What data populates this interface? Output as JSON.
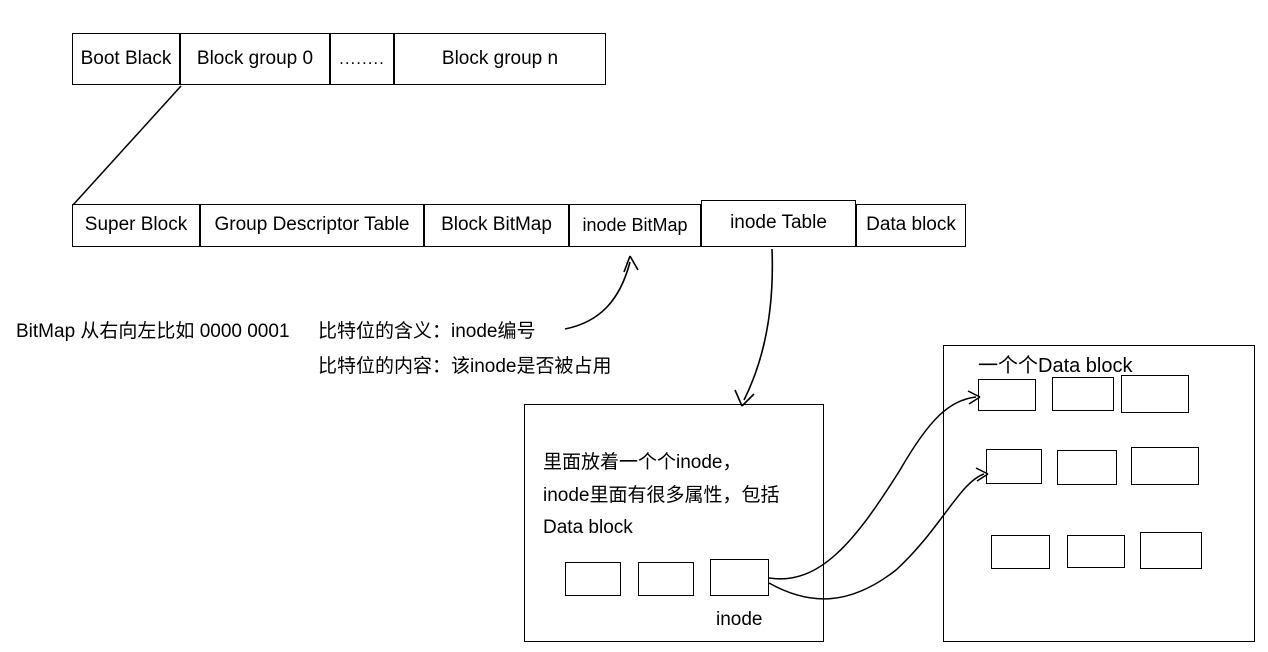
{
  "diagram": {
    "title_hidden": "ext2 filesystem layout hand-drawn diagram",
    "block_group_row": {
      "cells": [
        {
          "id": "boot",
          "label": "Boot Black"
        },
        {
          "id": "group0",
          "label": "Block group 0"
        },
        {
          "id": "ellipsis",
          "label": "........"
        },
        {
          "id": "groupn",
          "label": "Block group n"
        }
      ]
    },
    "group_detail_row": {
      "cells": [
        {
          "id": "super-block",
          "label": "Super Block"
        },
        {
          "id": "group-descriptor-table",
          "label": "Group Descriptor Table"
        },
        {
          "id": "block-bitmap",
          "label": "Block BitMap"
        },
        {
          "id": "inode-bitmap",
          "label": "inode BitMap"
        },
        {
          "id": "inode-table",
          "label": "inode Table"
        },
        {
          "id": "data-block",
          "label": "Data block"
        }
      ]
    },
    "notes": {
      "bitmap_note": "BitMap 从右向左比如 0000 0001",
      "bit_meaning": "比特位的含义：inode编号",
      "bit_content": "比特位的内容：该inode是否被占用"
    },
    "inode_table_panel": {
      "description_lines": [
        "里面放着一个个inode，",
        "inode里面有很多属性，包括",
        "Data block"
      ],
      "inode_label": "inode",
      "inode_boxes": [
        "",
        "",
        ""
      ]
    },
    "data_block_panel": {
      "title": "一个个Data block",
      "blocks": [
        "",
        "",
        "",
        "",
        "",
        "",
        "",
        "",
        ""
      ]
    },
    "colors": {
      "stroke": "#000000",
      "background": "#ffffff",
      "text": "#000000"
    }
  }
}
